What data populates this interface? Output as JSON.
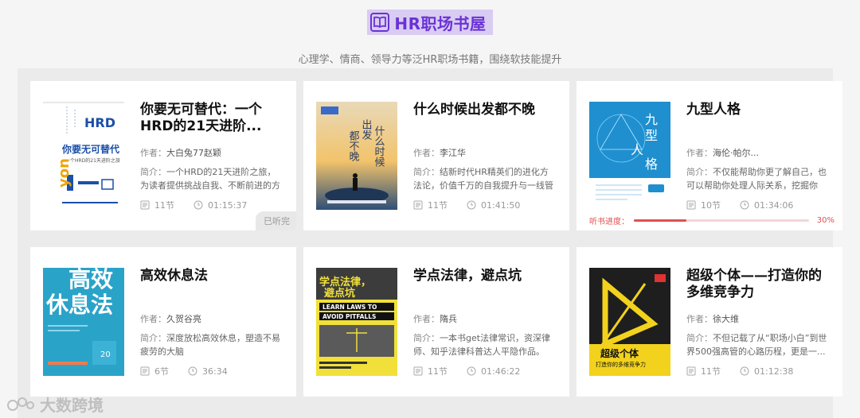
{
  "header": {
    "title": "HR职场书屋",
    "subtitle": "心理学、情商、领导力等泛HR职场书籍，围绕软技能提升"
  },
  "labels": {
    "author": "作者：",
    "intro": "简介：",
    "listened": "已听完",
    "progress": "听书进度："
  },
  "books": [
    {
      "title": "你要无可替代：一个HRD的21天进阶...",
      "author": "大白兔77赵颖",
      "intro": "一个HRD的21天进阶之旅，为读者提供挑战自我、不断前进的方法",
      "chapters": "11节",
      "duration": "01:15:37",
      "status": "已听完",
      "cover": {
        "text1": "HRD",
        "text2": "你要无可替代",
        "text3": "一个HRD的21天进阶之旅",
        "side": "yon",
        "bg": "#ffffff",
        "accent": "#1b4fa8"
      }
    },
    {
      "title": "什么时候出发都不晚",
      "author": "李江华",
      "intro": "结新时代HR精英们的进化方法论，价值千万的自我提升与一线管理...",
      "chapters": "11节",
      "duration": "01:41:50",
      "cover": {
        "text1": "什么时候",
        "text2": "出发都不晚",
        "bg": "#2f4f77",
        "accent": "#f2c36b"
      }
    },
    {
      "title": "九型人格",
      "author": "海伦·帕尔...",
      "intro": "不仅能帮助你更了解自己，也可以帮助你处理人际关系，挖掘你性...",
      "chapters": "10节",
      "duration": "01:34:06",
      "progress_percent": 30,
      "progress_label": "30%",
      "cover": {
        "text1": "九型",
        "text2": "人格",
        "bg": "#1f8fcf",
        "accent": "#ffffff"
      }
    },
    {
      "title": "高效休息法",
      "author": "久贺谷亮",
      "intro": "深度放松高效休息，塑造不易疲劳的大脑",
      "chapters": "6节",
      "duration": "36:34",
      "cover": {
        "text1": "高效",
        "text2": "休息法",
        "bg": "#2aa3c9",
        "accent": "#ffffff"
      }
    },
    {
      "title": "学点法律，避点坑",
      "author": "隋兵",
      "intro": "一本书get法律常识，资深律师、知乎法律科普达人平隐作品。",
      "chapters": "11节",
      "duration": "01:46:22",
      "cover": {
        "text1": "学点法律，",
        "text2": "避点坑",
        "text3": "LEARN LAWS TO",
        "text4": "AVOID PITFALLS",
        "bg": "#f1e03a",
        "accent": "#222222"
      }
    },
    {
      "title": "超级个体——打造你的多维竞争力",
      "author": "徐大维",
      "intro": "不但记载了从“职场小白”到世界500强高管的心路历程，更是一...",
      "chapters": "11节",
      "duration": "01:12:38",
      "cover": {
        "text1": "超级个体",
        "text2": "打造你的多维竞争力",
        "bg": "#1e1e1e",
        "accent": "#f3d21d"
      }
    }
  ],
  "watermark": "大数跨境"
}
